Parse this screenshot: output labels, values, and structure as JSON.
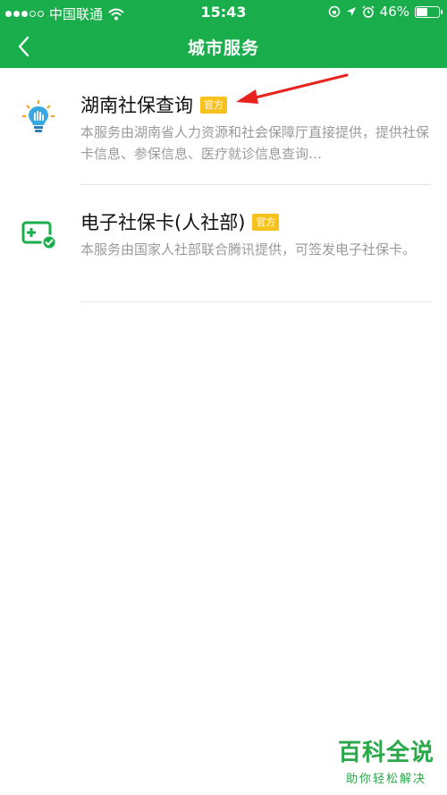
{
  "status_bar": {
    "carrier": "中国联通",
    "time": "15:43",
    "battery_percent": "46%",
    "battery_level": 0.46,
    "icons": [
      "wifi-icon",
      "lock-rotation-icon",
      "location-icon",
      "alarm-icon"
    ]
  },
  "nav": {
    "title": "城市服务",
    "back_icon": "chevron-left-icon"
  },
  "services": [
    {
      "name": "湖南社保查询",
      "badge": "官方",
      "desc": "本服务由湖南省人力资源和社会保障厅直接提供，提供社保卡信息、参保信息、医疗就诊信息查询…",
      "icon": "lightbulb-hand-icon"
    },
    {
      "name": "电子社保卡(人社部)",
      "badge": "官方",
      "desc": "本服务由国家人社部联合腾讯提供，可签发电子社保卡。",
      "icon": "card-plus-check-icon"
    }
  ],
  "watermark": {
    "title": "百科全说",
    "subtitle": "助你轻松解决"
  },
  "colors": {
    "brand_green": "#1aad4c",
    "badge_yellow": "#f7c21b",
    "annotation_red": "#e8231f"
  }
}
